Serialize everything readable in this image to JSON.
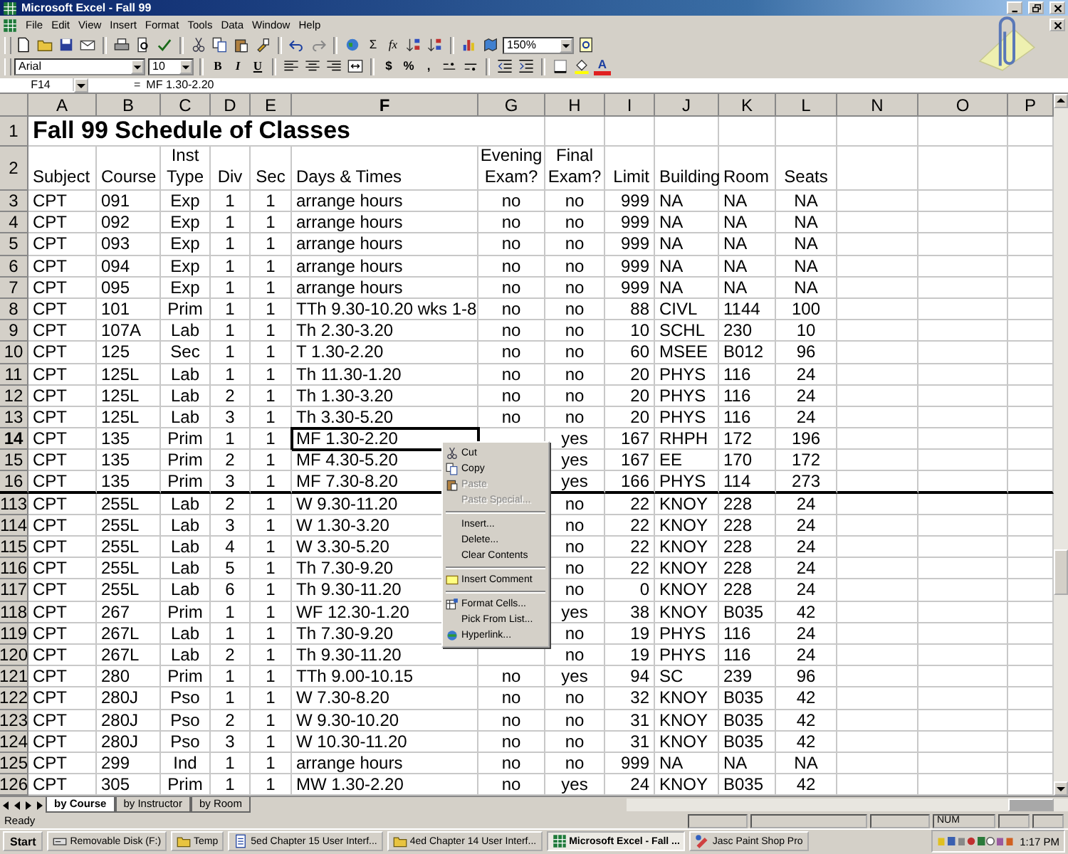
{
  "window": {
    "title": "Microsoft Excel - Fall 99"
  },
  "menu_bar": [
    "File",
    "Edit",
    "View",
    "Insert",
    "Format",
    "Tools",
    "Data",
    "Window",
    "Help"
  ],
  "standard_toolbar": {
    "autosum": "Σ",
    "function": "fx",
    "zoom": "150%"
  },
  "formatting_toolbar": {
    "font": "Arial",
    "font_size": "10",
    "styles": [
      "B",
      "I",
      "U"
    ],
    "number_formats": [
      "$",
      "%",
      ","
    ],
    "font_color": "A"
  },
  "formula_bar": {
    "name_box": "F14",
    "equals": "=",
    "formula": "MF 1.30-2.20"
  },
  "sheet": {
    "columns": [
      {
        "label": "A",
        "selected": false
      },
      {
        "label": "B",
        "selected": false
      },
      {
        "label": "C",
        "selected": false
      },
      {
        "label": "D",
        "selected": false
      },
      {
        "label": "E",
        "selected": false
      },
      {
        "label": "F",
        "selected": true
      },
      {
        "label": "G",
        "selected": false
      },
      {
        "label": "H",
        "selected": false
      },
      {
        "label": "I",
        "selected": false
      },
      {
        "label": "J",
        "selected": false
      },
      {
        "label": "K",
        "selected": false
      },
      {
        "label": "L",
        "selected": false
      },
      {
        "label": "N",
        "selected": false
      },
      {
        "label": "O",
        "selected": false
      },
      {
        "label": "P",
        "selected": false
      }
    ],
    "title_row": {
      "number": "1",
      "text": "Fall 99 Schedule of Classes"
    },
    "header_row": {
      "number": "2",
      "cells": [
        "Subject",
        "Course",
        "Inst\nType",
        "Div",
        "Sec",
        "Days & Times",
        "Evening\nExam?",
        "Final\nExam?",
        "Limit",
        "Building",
        "Room",
        "Seats"
      ]
    },
    "rows": [
      {
        "number": "3",
        "selected": false,
        "cells": [
          "CPT",
          "091",
          "Exp",
          "1",
          "1",
          "arrange hours",
          "no",
          "no",
          "999",
          "NA",
          "NA",
          "NA"
        ]
      },
      {
        "number": "4",
        "selected": false,
        "cells": [
          "CPT",
          "092",
          "Exp",
          "1",
          "1",
          "arrange hours",
          "no",
          "no",
          "999",
          "NA",
          "NA",
          "NA"
        ]
      },
      {
        "number": "5",
        "selected": false,
        "cells": [
          "CPT",
          "093",
          "Exp",
          "1",
          "1",
          "arrange hours",
          "no",
          "no",
          "999",
          "NA",
          "NA",
          "NA"
        ]
      },
      {
        "number": "6",
        "selected": false,
        "cells": [
          "CPT",
          "094",
          "Exp",
          "1",
          "1",
          "arrange hours",
          "no",
          "no",
          "999",
          "NA",
          "NA",
          "NA"
        ]
      },
      {
        "number": "7",
        "selected": false,
        "cells": [
          "CPT",
          "095",
          "Exp",
          "1",
          "1",
          "arrange hours",
          "no",
          "no",
          "999",
          "NA",
          "NA",
          "NA"
        ]
      },
      {
        "number": "8",
        "selected": false,
        "cells": [
          "CPT",
          "101",
          "Prim",
          "1",
          "1",
          "TTh 9.30-10.20 wks 1-8",
          "no",
          "no",
          "88",
          "CIVL",
          "1144",
          "100"
        ]
      },
      {
        "number": "9",
        "selected": false,
        "cells": [
          "CPT",
          "107A",
          "Lab",
          "1",
          "1",
          "Th 2.30-3.20",
          "no",
          "no",
          "10",
          "SCHL",
          "230",
          "10"
        ]
      },
      {
        "number": "10",
        "selected": false,
        "cells": [
          "CPT",
          "125",
          "Sec",
          "1",
          "1",
          "T 1.30-2.20",
          "no",
          "no",
          "60",
          "MSEE",
          "B012",
          "96"
        ]
      },
      {
        "number": "11",
        "selected": false,
        "cells": [
          "CPT",
          "125L",
          "Lab",
          "1",
          "1",
          "Th 11.30-1.20",
          "no",
          "no",
          "20",
          "PHYS",
          "116",
          "24"
        ]
      },
      {
        "number": "12",
        "selected": false,
        "cells": [
          "CPT",
          "125L",
          "Lab",
          "2",
          "1",
          "Th 1.30-3.20",
          "no",
          "no",
          "20",
          "PHYS",
          "116",
          "24"
        ]
      },
      {
        "number": "13",
        "selected": false,
        "cells": [
          "CPT",
          "125L",
          "Lab",
          "3",
          "1",
          "Th 3.30-5.20",
          "no",
          "no",
          "20",
          "PHYS",
          "116",
          "24"
        ]
      },
      {
        "number": "14",
        "selected": true,
        "cells": [
          "CPT",
          "135",
          "Prim",
          "1",
          "1",
          "MF 1.30-2.20",
          null,
          "yes",
          "167",
          "RHPH",
          "172",
          "196"
        ]
      },
      {
        "number": "15",
        "selected": false,
        "cells": [
          "CPT",
          "135",
          "Prim",
          "2",
          "1",
          "MF 4.30-5.20",
          null,
          "yes",
          "167",
          "EE",
          "170",
          "172"
        ]
      },
      {
        "number": "16",
        "selected": false,
        "cells": [
          "CPT",
          "135",
          "Prim",
          "3",
          "1",
          "MF 7.30-8.20",
          null,
          "yes",
          "166",
          "PHYS",
          "114",
          "273"
        ]
      },
      {
        "number": "113",
        "selected": false,
        "cells": [
          "CPT",
          "255L",
          "Lab",
          "2",
          "1",
          "W 9.30-11.20",
          null,
          "no",
          "22",
          "KNOY",
          "228",
          "24"
        ]
      },
      {
        "number": "114",
        "selected": false,
        "cells": [
          "CPT",
          "255L",
          "Lab",
          "3",
          "1",
          "W 1.30-3.20",
          null,
          "no",
          "22",
          "KNOY",
          "228",
          "24"
        ]
      },
      {
        "number": "115",
        "selected": false,
        "cells": [
          "CPT",
          "255L",
          "Lab",
          "4",
          "1",
          "W 3.30-5.20",
          null,
          "no",
          "22",
          "KNOY",
          "228",
          "24"
        ]
      },
      {
        "number": "116",
        "selected": false,
        "cells": [
          "CPT",
          "255L",
          "Lab",
          "5",
          "1",
          "Th 7.30-9.20",
          null,
          "no",
          "22",
          "KNOY",
          "228",
          "24"
        ]
      },
      {
        "number": "117",
        "selected": false,
        "cells": [
          "CPT",
          "255L",
          "Lab",
          "6",
          "1",
          "Th 9.30-11.20",
          null,
          "no",
          "0",
          "KNOY",
          "228",
          "24"
        ]
      },
      {
        "number": "118",
        "selected": false,
        "cells": [
          "CPT",
          "267",
          "Prim",
          "1",
          "1",
          "WF 12.30-1.20",
          null,
          "yes",
          "38",
          "KNOY",
          "B035",
          "42"
        ]
      },
      {
        "number": "119",
        "selected": false,
        "cells": [
          "CPT",
          "267L",
          "Lab",
          "1",
          "1",
          "Th 7.30-9.20",
          null,
          "no",
          "19",
          "PHYS",
          "116",
          "24"
        ]
      },
      {
        "number": "120",
        "selected": false,
        "cells": [
          "CPT",
          "267L",
          "Lab",
          "2",
          "1",
          "Th 9.30-11.20",
          null,
          "no",
          "19",
          "PHYS",
          "116",
          "24"
        ]
      },
      {
        "number": "121",
        "selected": false,
        "cells": [
          "CPT",
          "280",
          "Prim",
          "1",
          "1",
          "TTh 9.00-10.15",
          "no",
          "yes",
          "94",
          "SC",
          "239",
          "96"
        ]
      },
      {
        "number": "122",
        "selected": false,
        "cells": [
          "CPT",
          "280J",
          "Pso",
          "1",
          "1",
          "W 7.30-8.20",
          "no",
          "no",
          "32",
          "KNOY",
          "B035",
          "42"
        ]
      },
      {
        "number": "123",
        "selected": false,
        "cells": [
          "CPT",
          "280J",
          "Pso",
          "2",
          "1",
          "W 9.30-10.20",
          "no",
          "no",
          "31",
          "KNOY",
          "B035",
          "42"
        ]
      },
      {
        "number": "124",
        "selected": false,
        "cells": [
          "CPT",
          "280J",
          "Pso",
          "3",
          "1",
          "W 10.30-11.20",
          "no",
          "no",
          "31",
          "KNOY",
          "B035",
          "42"
        ]
      },
      {
        "number": "125",
        "selected": false,
        "cells": [
          "CPT",
          "299",
          "Ind",
          "1",
          "1",
          "arrange hours",
          "no",
          "no",
          "999",
          "NA",
          "NA",
          "NA"
        ]
      },
      {
        "number": "126",
        "selected": false,
        "cells": [
          "CPT",
          "305",
          "Prim",
          "1",
          "1",
          "MW 1.30-2.20",
          "no",
          "yes",
          "24",
          "KNOY",
          "B035",
          "42"
        ]
      }
    ]
  },
  "context_menu": [
    {
      "label": "Cut",
      "disabled": false,
      "separator_before": false
    },
    {
      "label": "Copy",
      "disabled": false,
      "separator_before": false
    },
    {
      "label": "Paste",
      "disabled": true,
      "separator_before": false
    },
    {
      "label": "Paste Special...",
      "disabled": true,
      "separator_before": false
    },
    {
      "label": "Insert...",
      "disabled": false,
      "separator_before": true
    },
    {
      "label": "Delete...",
      "disabled": false,
      "separator_before": false
    },
    {
      "label": "Clear Contents",
      "disabled": false,
      "separator_before": false
    },
    {
      "label": "Insert Comment",
      "disabled": false,
      "separator_before": true
    },
    {
      "label": "Format Cells...",
      "disabled": false,
      "separator_before": true
    },
    {
      "label": "Pick From List...",
      "disabled": false,
      "separator_before": false
    },
    {
      "label": "Hyperlink...",
      "disabled": false,
      "separator_before": false
    }
  ],
  "sheet_tabs": [
    {
      "label": "by Course",
      "selected": true
    },
    {
      "label": "by Instructor",
      "selected": false
    },
    {
      "label": "by Room",
      "selected": false
    }
  ],
  "status_bar": {
    "text": "Ready",
    "indicator": "NUM"
  },
  "taskbar": {
    "start": "Start",
    "buttons": [
      {
        "label": "Removable Disk (F:)",
        "selected": false
      },
      {
        "label": "Temp",
        "selected": false
      },
      {
        "label": "5ed Chapter 15 User Interf...",
        "selected": false
      },
      {
        "label": "4ed Chapter 14 User Interf...",
        "selected": false
      },
      {
        "label": "Microsoft Excel - Fall ...",
        "selected": true
      },
      {
        "label": "Jasc Paint Shop Pro",
        "selected": false
      }
    ],
    "clock": "1:17 PM"
  }
}
